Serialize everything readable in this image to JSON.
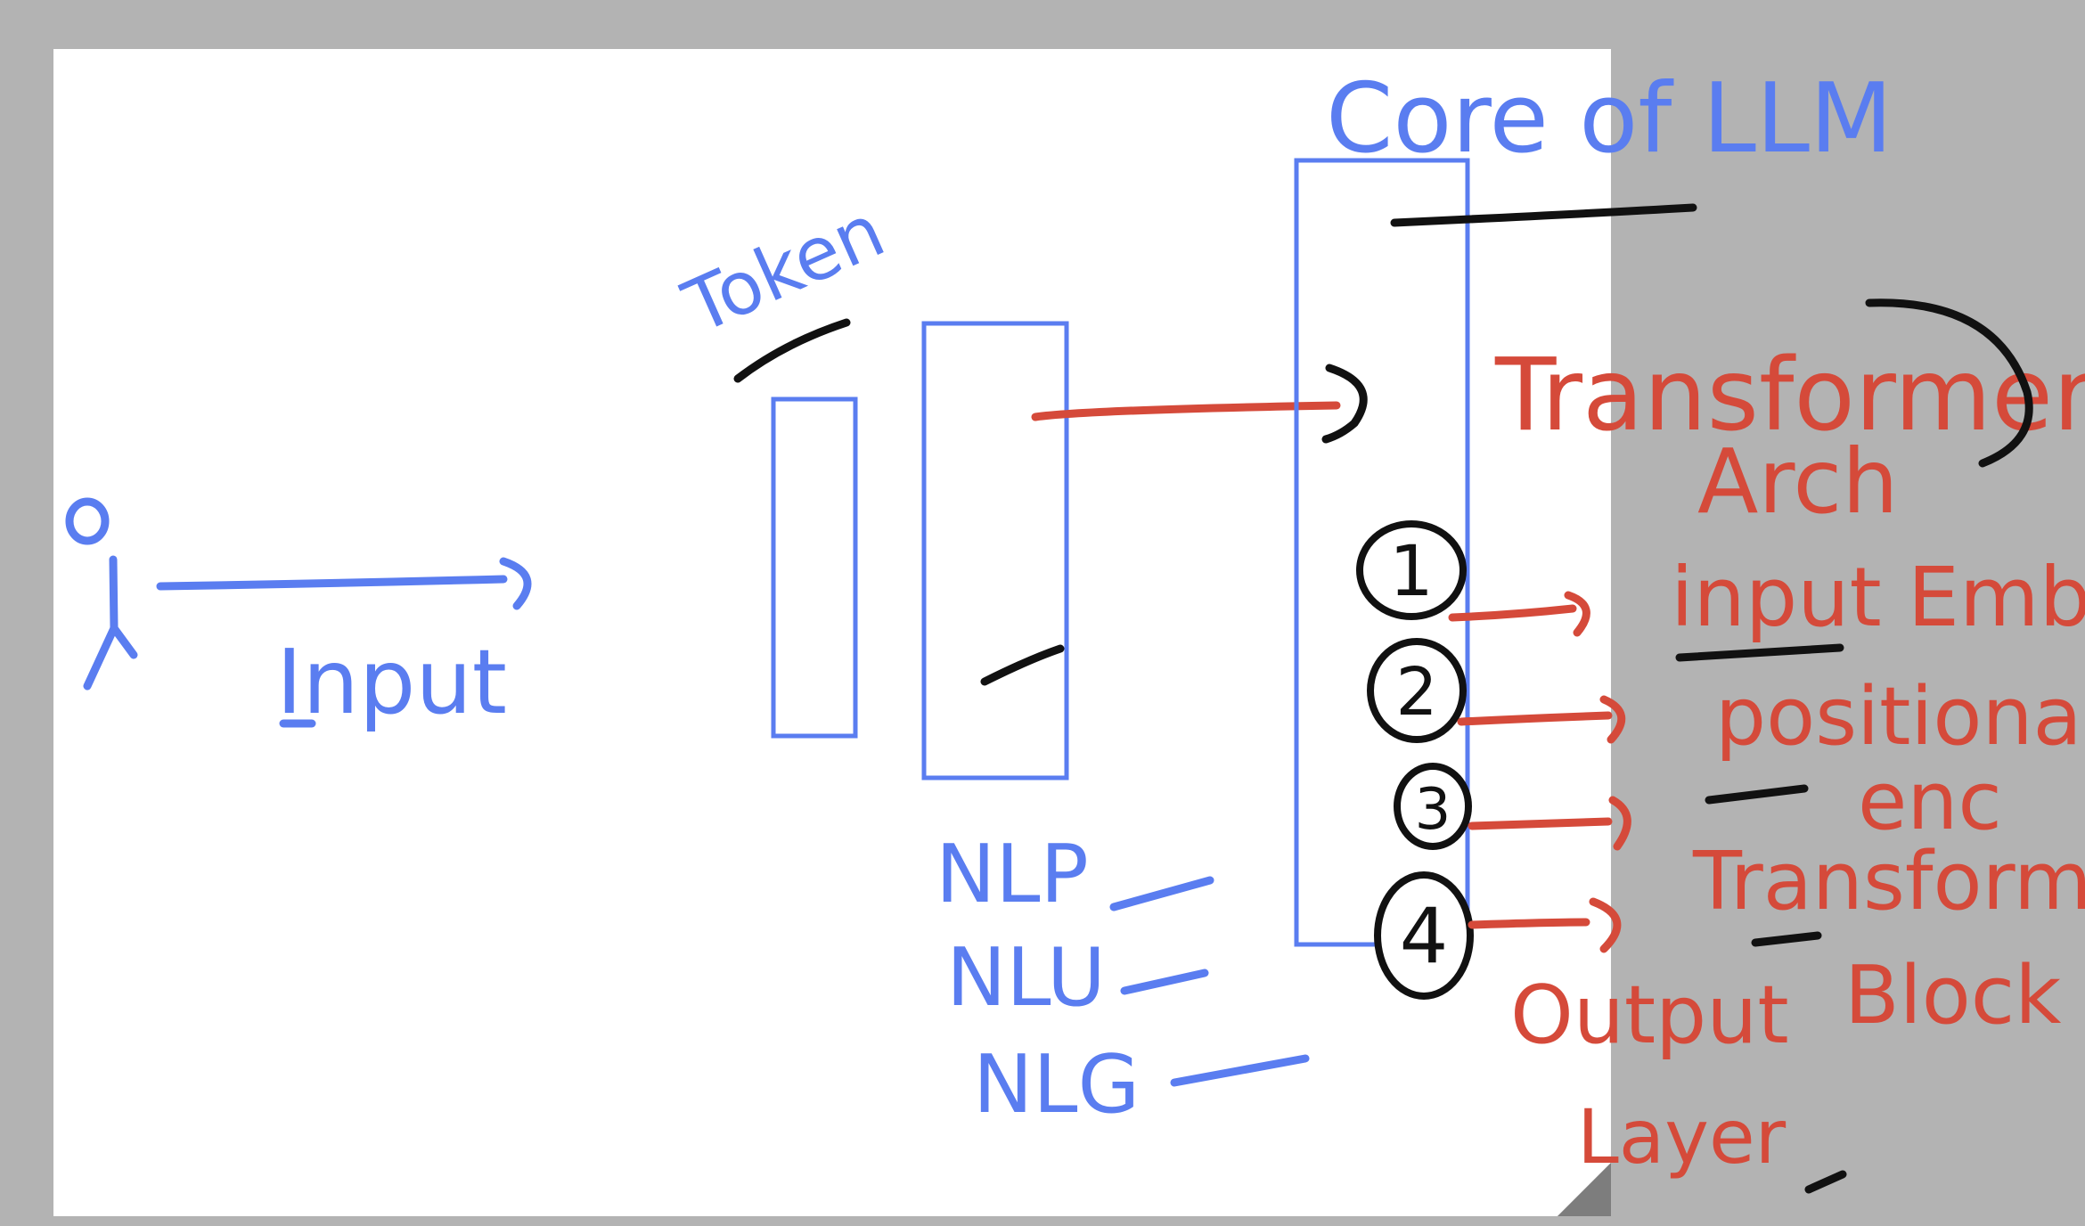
{
  "labels": {
    "input": "Input",
    "token": "Token",
    "core": "Core of LLM",
    "nlp": "NLP",
    "nlu": "NLU",
    "nlg": "NLG",
    "transformer": "Transformer",
    "arch": "Arch",
    "steps": [
      {
        "num": "1",
        "text": "input Emb"
      },
      {
        "num": "2",
        "text": "positional"
      },
      {
        "num": "3",
        "text": "enc"
      },
      {
        "num": "4",
        "text": "Transformer"
      }
    ],
    "block": "Block",
    "output": "Output",
    "layer": "Layer"
  },
  "colors": {
    "blue": "#5a7df0",
    "red": "#d54a3a",
    "black": "#111111",
    "background": "#b3b3b3",
    "paper": "#ffffff"
  }
}
